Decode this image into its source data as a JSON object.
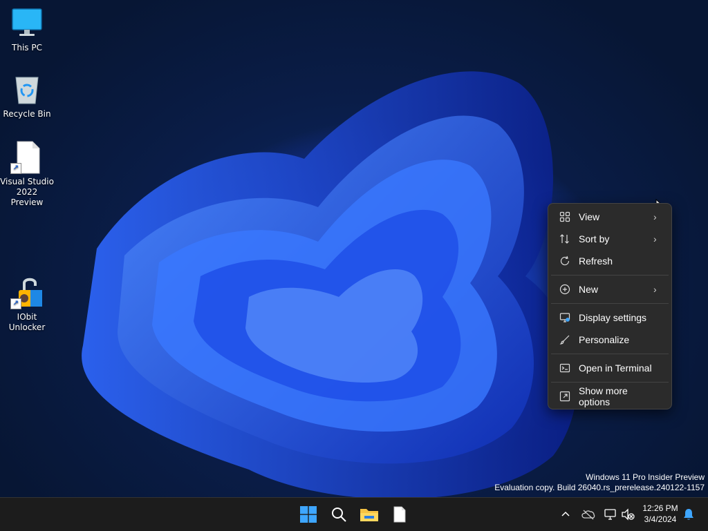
{
  "desktop": {
    "icons": [
      {
        "label": "This PC"
      },
      {
        "label": "Recycle Bin"
      },
      {
        "label": "Visual Studio 2022 Preview"
      },
      {
        "label": "IObit Unlocker"
      }
    ]
  },
  "context_menu": {
    "items": [
      {
        "label": "View",
        "icon": "view-grid-icon",
        "submenu": true
      },
      {
        "label": "Sort by",
        "icon": "sort-icon",
        "submenu": true
      },
      {
        "label": "Refresh",
        "icon": "refresh-icon",
        "submenu": false
      },
      {
        "label": "New",
        "icon": "plus-circle-icon",
        "submenu": true
      },
      {
        "label": "Display settings",
        "icon": "display-settings-icon",
        "submenu": false
      },
      {
        "label": "Personalize",
        "icon": "brush-icon",
        "submenu": false
      },
      {
        "label": "Open in Terminal",
        "icon": "terminal-icon",
        "submenu": false
      },
      {
        "label": "Show more options",
        "icon": "show-more-icon",
        "submenu": false
      }
    ],
    "submenu_glyph": "›"
  },
  "watermark": {
    "line1": "Windows 11 Pro Insider Preview",
    "line2": "Evaluation copy. Build 26040.rs_prerelease.240122-1157"
  },
  "taskbar": {
    "clock": {
      "time": "12:26 PM",
      "date": "3/4/2024"
    },
    "tray_chevron": "^"
  },
  "colors": {
    "taskbar_bg": "#1c1c1c",
    "menu_bg": "#2b2b2b",
    "accent": "#3ea6ff",
    "wallpaper_blue": "#1d4fe0"
  }
}
